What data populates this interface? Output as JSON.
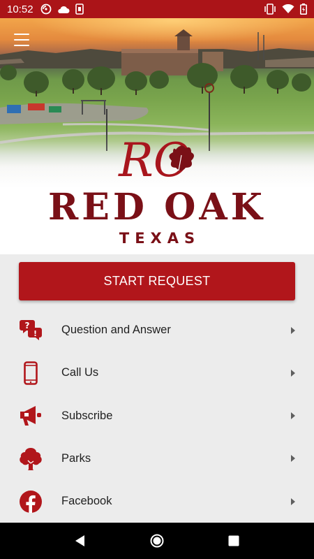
{
  "status_bar": {
    "time": "10:52",
    "icons_left": [
      "cast-icon",
      "cloud-icon",
      "sim-icon"
    ],
    "icons_right": [
      "vibrate-icon",
      "wifi-icon",
      "battery-icon"
    ]
  },
  "header": {
    "menu_icon": "hamburger-menu-icon",
    "logo": {
      "monogram": "RO",
      "name": "RED OAK",
      "subtitle": "TEXAS"
    }
  },
  "start_request": {
    "label": "START REQUEST"
  },
  "menu": {
    "items": [
      {
        "label": "Question and Answer",
        "icon": "question-bubbles-icon"
      },
      {
        "label": "Call Us",
        "icon": "phone-icon"
      },
      {
        "label": "Subscribe",
        "icon": "megaphone-icon"
      },
      {
        "label": "Parks",
        "icon": "tree-icon"
      },
      {
        "label": "Facebook",
        "icon": "facebook-icon"
      }
    ]
  },
  "nav_bar": {
    "icons": [
      "back-icon",
      "home-icon",
      "recents-icon"
    ]
  },
  "colors": {
    "brand_red": "#b1161b",
    "logo_maroon": "#7a1017",
    "status_bar": "#ab1418"
  }
}
